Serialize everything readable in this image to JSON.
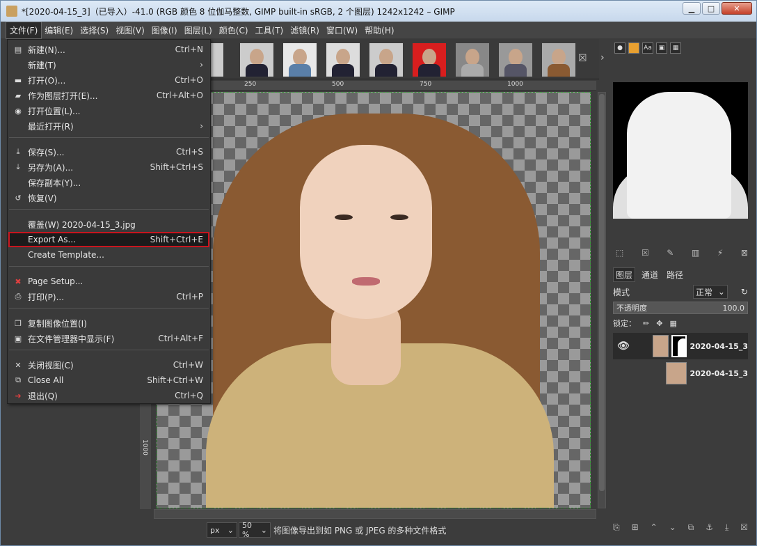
{
  "window": {
    "title": "*[2020-04-15_3]（已导入）-41.0 (RGB 颜色 8 位伽马整数, GIMP built-in sRGB, 2 个图层) 1242x1242 – GIMP",
    "min_label": "▁",
    "max_label": "□",
    "close_label": "✕"
  },
  "menubar": [
    "文件(F)",
    "编辑(E)",
    "选择(S)",
    "视图(V)",
    "图像(I)",
    "图层(L)",
    "颜色(C)",
    "工具(T)",
    "滤镜(R)",
    "窗口(W)",
    "帮助(H)"
  ],
  "file_menu": {
    "items": [
      {
        "label": "新建(N)...",
        "shortcut": "Ctrl+N",
        "icon": "new-image-icon",
        "glyph": "▤"
      },
      {
        "label": "新建(T)",
        "shortcut": "›",
        "icon": "",
        "glyph": ""
      },
      {
        "label": "打开(O)...",
        "shortcut": "Ctrl+O",
        "icon": "open-icon",
        "glyph": "▬"
      },
      {
        "label": "作为图层打开(E)...",
        "shortcut": "Ctrl+Alt+O",
        "icon": "open-as-layer-icon",
        "glyph": "▰"
      },
      {
        "label": "打开位置(L)...",
        "shortcut": "",
        "icon": "open-location-icon",
        "glyph": "◉"
      },
      {
        "label": "最近打开(R)",
        "shortcut": "›",
        "icon": "",
        "glyph": ""
      },
      {
        "label": "保存(S)...",
        "shortcut": "Ctrl+S",
        "icon": "save-icon",
        "glyph": "⤓"
      },
      {
        "label": "另存为(A)...",
        "shortcut": "Shift+Ctrl+S",
        "icon": "save-as-icon",
        "glyph": "⤓"
      },
      {
        "label": "保存副本(Y)...",
        "shortcut": "",
        "icon": "",
        "glyph": ""
      },
      {
        "label": "恢复(V)",
        "shortcut": "",
        "icon": "revert-icon",
        "glyph": "↺"
      },
      {
        "label": "覆盖(W) 2020-04-15_3.jpg",
        "shortcut": "",
        "icon": "",
        "glyph": ""
      },
      {
        "label": "Export As...",
        "shortcut": "Shift+Ctrl+E",
        "icon": "",
        "glyph": ""
      },
      {
        "label": "Create Template...",
        "shortcut": "",
        "icon": "",
        "glyph": ""
      },
      {
        "label": "Page Setup...",
        "shortcut": "",
        "icon": "page-setup-icon",
        "glyph": "✖"
      },
      {
        "label": "打印(P)...",
        "shortcut": "Ctrl+P",
        "icon": "print-icon",
        "glyph": "⎙"
      },
      {
        "label": "复制图像位置(I)",
        "shortcut": "",
        "icon": "copy-location-icon",
        "glyph": "❐"
      },
      {
        "label": "在文件管理器中显示(F)",
        "shortcut": "Ctrl+Alt+F",
        "icon": "file-manager-icon",
        "glyph": "▣"
      },
      {
        "label": "关闭视图(C)",
        "shortcut": "Ctrl+W",
        "icon": "close-view-icon",
        "glyph": "✕"
      },
      {
        "label": "Close All",
        "shortcut": "Shift+Ctrl+W",
        "icon": "close-all-icon",
        "glyph": "⧉"
      },
      {
        "label": "退出(Q)",
        "shortcut": "Ctrl+Q",
        "icon": "quit-icon",
        "glyph": "➜"
      }
    ]
  },
  "ruler": {
    "ticks": [
      "250",
      "500",
      "750",
      "1000"
    ],
    "vticks": [
      "1000"
    ]
  },
  "statusbar": {
    "unit": "px",
    "zoom": "50 %",
    "message": "将图像导出到如 PNG 或 JPEG 的多种文件格式"
  },
  "dock": {
    "tabs": [
      "图层",
      "通道",
      "路径"
    ],
    "mode_label": "模式",
    "mode_value": "正常",
    "opacity_label": "不透明度",
    "opacity_value": "100.0",
    "lock_label": "锁定：",
    "layers": [
      {
        "name": "2020-04-15_3",
        "visible": true,
        "has_mask": true
      },
      {
        "name": "2020-04-15_3",
        "visible": false,
        "has_mask": false
      }
    ]
  },
  "colors": {
    "highlight_border": "#c8151e",
    "selection_border": "#3c9c3c",
    "background": "#3c3c3c"
  }
}
